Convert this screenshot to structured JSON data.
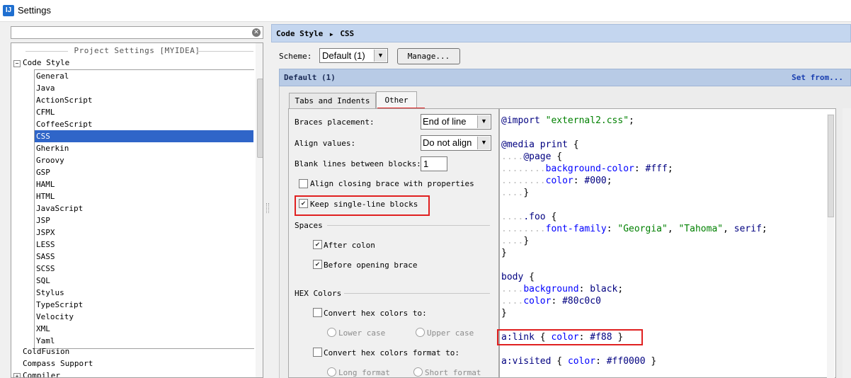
{
  "window": {
    "title": "Settings",
    "logo_text": "IJ"
  },
  "search": {
    "value": "",
    "clear_glyph": "✕"
  },
  "tree": {
    "header": "Project Settings [MYIDEA]",
    "root_expanded": "Code Style",
    "toggle_minus": "−",
    "toggle_plus": "+",
    "code_style_items": [
      "General",
      "Java",
      "ActionScript",
      "CFML",
      "CoffeeScript",
      "CSS",
      "Gherkin",
      "Groovy",
      "GSP",
      "HAML",
      "HTML",
      "JavaScript",
      "JSP",
      "JSPX",
      "LESS",
      "SASS",
      "SCSS",
      "SQL",
      "Stylus",
      "TypeScript",
      "Velocity",
      "XML",
      "Yaml"
    ],
    "selected": "CSS",
    "other_roots": [
      "ColdFusion",
      "Compass Support",
      "Compiler"
    ]
  },
  "breadcrumb": {
    "parent": "Code Style",
    "current": "CSS",
    "separator": "▶"
  },
  "scheme": {
    "label": "Scheme:",
    "value": "Default (1)",
    "manage": "Manage..."
  },
  "panel": {
    "title": "Default (1)",
    "set_from": "Set from..."
  },
  "tabs": [
    {
      "label": "Tabs and Indents",
      "active": false
    },
    {
      "label": "Other",
      "active": true
    }
  ],
  "settings": {
    "braces_label": "Braces placement:",
    "braces_value": "End of line",
    "align_label": "Align values:",
    "align_value": "Do not align",
    "blank_label": "Blank lines between blocks:",
    "blank_value": "1",
    "align_closing": {
      "label": "Align closing brace with properties",
      "checked": false
    },
    "keep_single": {
      "label": "Keep single-line blocks",
      "checked": true
    },
    "spaces_header": "Spaces",
    "after_colon": {
      "label": "After colon",
      "checked": true
    },
    "before_brace": {
      "label": "Before opening brace",
      "checked": true
    },
    "hex_header": "HEX Colors",
    "convert_hex": {
      "label": "Convert hex colors to:",
      "checked": false
    },
    "lower_case": "Lower case",
    "upper_case": "Upper case",
    "convert_format": {
      "label": "Convert hex colors format to:",
      "checked": false
    },
    "long_format": "Long format",
    "short_format": "Short format"
  },
  "dropdown_glyph": "▼",
  "check_glyph": "✔",
  "preview": {
    "l1_kw": "@import",
    "l1_str": "\"external2.css\"",
    "l1_end": ";",
    "l2_kw": "@media print",
    "l2_end": "{",
    "l3_kw": "@page",
    "l3_end": "{",
    "l4_prop": "background-color",
    "l4_val": "#fff",
    "l5_prop": "color",
    "l5_val": "#000",
    "l6": "}",
    "l7_sel": ".foo",
    "l7_end": "{",
    "l8_prop": "font-family",
    "l8_s1": "\"Georgia\"",
    "l8_s2": "\"Tahoma\"",
    "l8_v": "serif",
    "l9": "}",
    "l10": "}",
    "l11_sel": "body",
    "l11_end": "{",
    "l12_prop": "background",
    "l12_val": "black",
    "l13_prop": "color",
    "l13_val": "#80c0c0",
    "l14": "}",
    "l15_sel": "a:link",
    "l15_open": "{",
    "l15_prop": "color",
    "l15_val": "#f88",
    "l15_close": "}",
    "l16_sel": "a:visited",
    "l16_open": "{",
    "l16_prop": "color",
    "l16_val": "#ff0000",
    "l16_close": "}"
  },
  "colors": {
    "selection": "#2f65c8",
    "highlight_box": "#e02020",
    "header_bar": "#c4d6ef"
  }
}
